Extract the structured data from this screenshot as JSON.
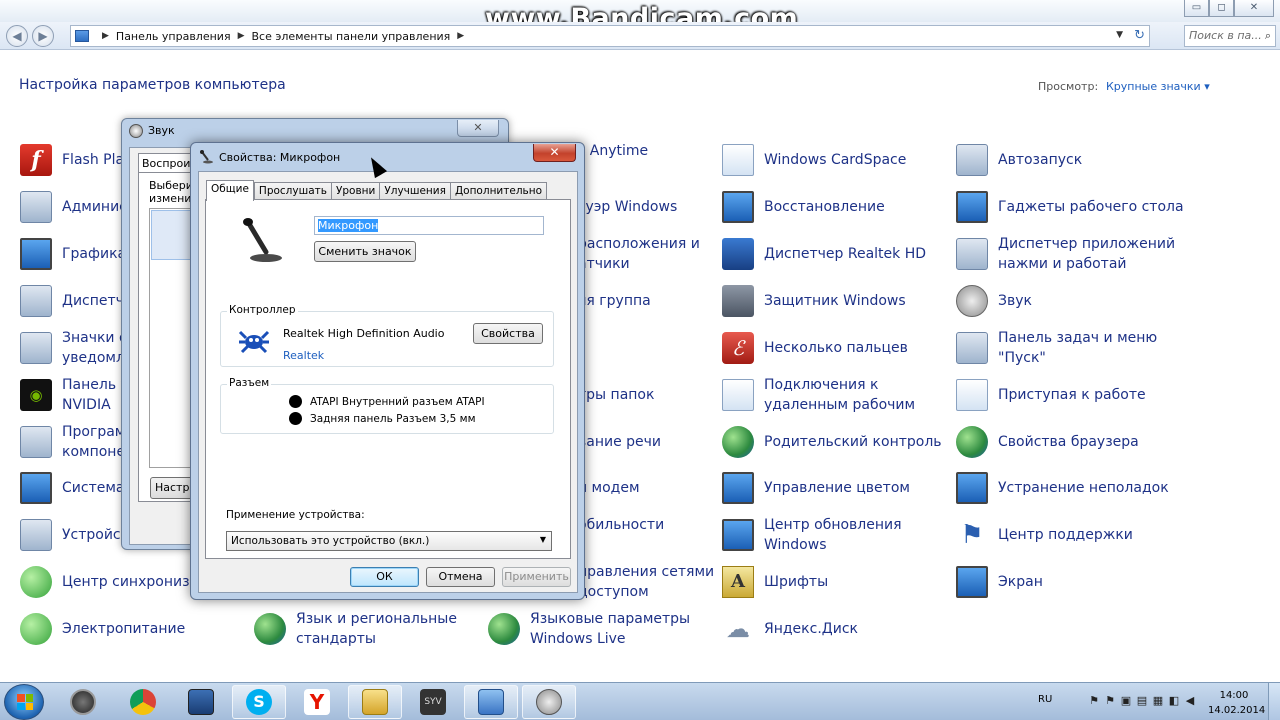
{
  "watermark": "www.Bandicam.com",
  "window": {
    "minimize": "▭",
    "maximize": "◻",
    "close": "✕"
  },
  "address": {
    "crumbs": [
      "Панель управления",
      "Все элементы панели управления"
    ],
    "search_placeholder": "Поиск в па..."
  },
  "page": {
    "heading": "Настройка параметров компьютера",
    "view_label": "Просмотр:",
    "view_value": "Крупные значки ▾"
  },
  "control_panel": {
    "col1": [
      {
        "label": "Flash Player",
        "icon": "flash-icon"
      },
      {
        "label": "Админис",
        "icon": "admin-tools-icon"
      },
      {
        "label": "Графика",
        "icon": "graphics-icon"
      },
      {
        "label": "Диспетче",
        "icon": "device-manager-icon"
      },
      {
        "label": "Значки о\nуведомл",
        "icon": "notification-icons-icon"
      },
      {
        "label": "Панель у\nNVIDIA",
        "icon": "nvidia-icon"
      },
      {
        "label": "Програм\nкомпоне",
        "icon": "programs-icon"
      },
      {
        "label": "Система",
        "icon": "system-icon"
      },
      {
        "label": "Устройст",
        "icon": "devices-icon"
      },
      {
        "label": "Центр синхронизации",
        "icon": "sync-center-icon"
      },
      {
        "label": "Электропитание",
        "icon": "power-icon"
      }
    ],
    "col2": [
      {
        "label": "Язык и региональные\nстандарты",
        "icon": "region-icon"
      }
    ],
    "col3": [
      {
        "label": "s Anytime",
        "icon": ""
      },
      {
        "label": "зуэр Windows",
        "icon": ""
      },
      {
        "label": "расположения и\nатчики",
        "icon": ""
      },
      {
        "label": "яя группа",
        "icon": ""
      },
      {
        "label": "тры папок",
        "icon": ""
      },
      {
        "label": "вание речи",
        "icon": ""
      },
      {
        "label": "и модем",
        "icon": ""
      },
      {
        "label": "обильности\ns",
        "icon": ""
      },
      {
        "label": "правления сетями\nдоступом",
        "icon": ""
      },
      {
        "label": "Языковые параметры\nWindows Live",
        "icon": "live-language-icon"
      }
    ],
    "col4": [
      {
        "label": "Windows CardSpace",
        "icon": "cardspace-icon"
      },
      {
        "label": "Восстановление",
        "icon": "recovery-icon"
      },
      {
        "label": "Диспетчер Realtek HD",
        "icon": "realtek-icon"
      },
      {
        "label": "Защитник Windows",
        "icon": "defender-icon"
      },
      {
        "label": "Несколько пальцев",
        "icon": "fingers-icon"
      },
      {
        "label": "Подключения к\nудаленным рабочим",
        "icon": "remote-icon"
      },
      {
        "label": "Родительский контроль",
        "icon": "parental-icon"
      },
      {
        "label": "Управление цветом",
        "icon": "color-icon"
      },
      {
        "label": "Центр обновления\nWindows",
        "icon": "update-icon"
      },
      {
        "label": "Шрифты",
        "icon": "fonts-icon"
      },
      {
        "label": "Яндекс.Диск",
        "icon": "yandex-disk-icon"
      }
    ],
    "col5": [
      {
        "label": "Автозапуск",
        "icon": "autoplay-icon"
      },
      {
        "label": "Гаджеты рабочего стола",
        "icon": "gadgets-icon"
      },
      {
        "label": "Диспетчер приложений\nнажми и работай",
        "icon": "apps-icon"
      },
      {
        "label": "Звук",
        "icon": "sound-icon"
      },
      {
        "label": "Панель задач и меню\n\"Пуск\"",
        "icon": "taskbar-icon"
      },
      {
        "label": "Приступая к работе",
        "icon": "getting-started-icon"
      },
      {
        "label": "Свойства браузера",
        "icon": "browser-icon"
      },
      {
        "label": "Устранение неполадок",
        "icon": "troubleshoot-icon"
      },
      {
        "label": "Центр поддержки",
        "icon": "action-center-icon"
      },
      {
        "label": "Экран",
        "icon": "display-icon"
      }
    ]
  },
  "sound_dialog": {
    "title": "Звук",
    "close": "✕",
    "tab": "Воспроизв",
    "desc": "Выберит\nизменит",
    "configure": "Настро"
  },
  "mic_dialog": {
    "title": "Свойства: Микрофон",
    "close": "✕",
    "tabs": [
      "Общие",
      "Прослушать",
      "Уровни",
      "Улучшения",
      "Дополнительно"
    ],
    "name_value": "Микрофон",
    "change_icon": "Сменить значок",
    "controller_label": "Контроллер",
    "controller_name": "Realtek High Definition Audio",
    "controller_vendor": "Realtek",
    "properties": "Свойства",
    "connector_label": "Разъем",
    "jacks": [
      "ATAPI Внутренний разъем ATAPI",
      "Задняя панель Разъем 3,5 мм"
    ],
    "usage_label": "Применение устройства:",
    "usage_value": "Использовать это устройство (вкл.)",
    "ok": "ОК",
    "cancel": "Отмена",
    "apply": "Применить"
  },
  "taskbar": {
    "lang": "RU",
    "time": "14:00",
    "date": "14.02.2014"
  }
}
